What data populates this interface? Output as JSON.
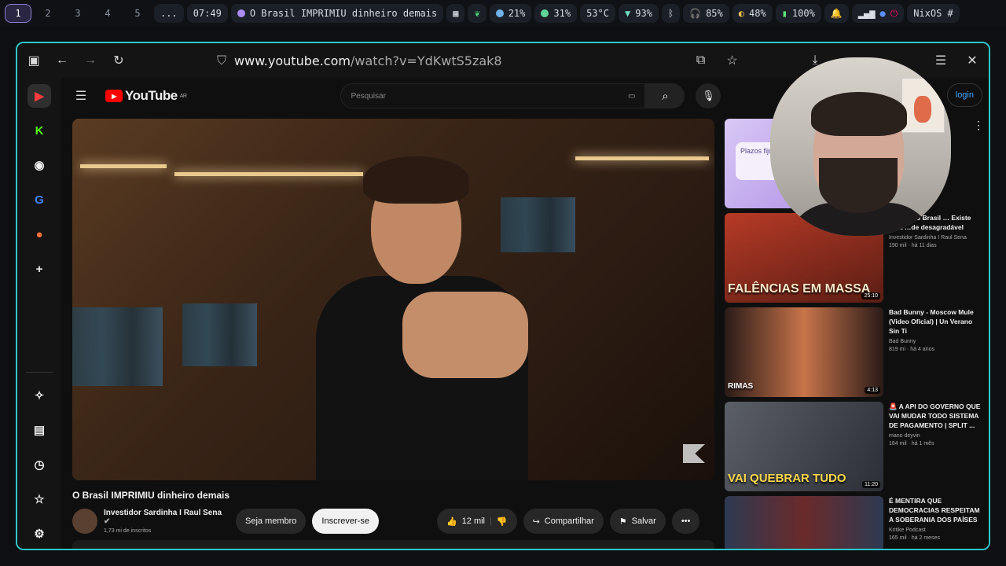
{
  "system_bar": {
    "workspaces": [
      "1",
      "2",
      "3",
      "4",
      "5",
      "..."
    ],
    "active_workspace": "1",
    "clock": "07:49",
    "window_title": "O Brasil IMPRIMIU dinheiro demais",
    "cpu": "21%",
    "memory": "31%",
    "temperature": "53°C",
    "wifi": "93%",
    "headphones": "85%",
    "brightness": "48%",
    "battery": "100%",
    "os_label": "NixOS #"
  },
  "browser": {
    "url_host": "www.youtube.com",
    "url_path": "/watch?v=YdKwtS5zak8"
  },
  "youtube": {
    "logo": "YouTube",
    "region": "AR",
    "search_placeholder": "Pesquisar",
    "login_label": "login",
    "video_title": "O Brasil IMPRIMIU dinheiro demais",
    "channel_name": "Investidor Sardinha I Raul Sena",
    "subscribers": "1,73 mi de inscritos",
    "member_label": "Seja membro",
    "subscribe_label": "Inscrever-se",
    "likes": "12 mil",
    "share_label": "Compartilhar",
    "save_label": "Salvar",
    "recommendations": [
      {
        "title": "Plazos fijos",
        "channel": "",
        "meta": "",
        "duration": "",
        "color": "#b9a3e6",
        "thumb_text": ""
      },
      {
        "title": "…esas do Brasil … Existe uma …de desagradável",
        "channel": "Investidor Sardinha I Raul Sena",
        "meta": "190 mil · há 11 dias",
        "duration": "25:10",
        "color": "#7a2a1f",
        "thumb_text": "FALÊNCIAS EM MASSA"
      },
      {
        "title": "Bad Bunny - Moscow Mule (Video Oficial) | Un Verano Sin Ti",
        "channel": "Bad Bunny",
        "meta": "819 mi · há 4 anos",
        "duration": "4:13",
        "color": "#4a2a2a",
        "thumb_text": "RIMAS"
      },
      {
        "title": "🚨 A API DO GOVERNO QUE VAI MUDAR TODO SISTEMA DE PAGAMENTO | SPLIT ...",
        "channel": "mano deyvin",
        "meta": "184 mil · há 1 mês",
        "duration": "11:20",
        "color": "#3b3f45",
        "thumb_text": "VAI QUEBRAR TUDO"
      },
      {
        "title": "É MENTIRA QUE DEMOCRACIAS RESPEITAM A SOBERANIA DOS PAÍSES",
        "channel": "Kritike Podcast",
        "meta": "165 mil · há 2 meses",
        "duration": "",
        "color": "#2c3038",
        "thumb_text": ""
      }
    ]
  }
}
